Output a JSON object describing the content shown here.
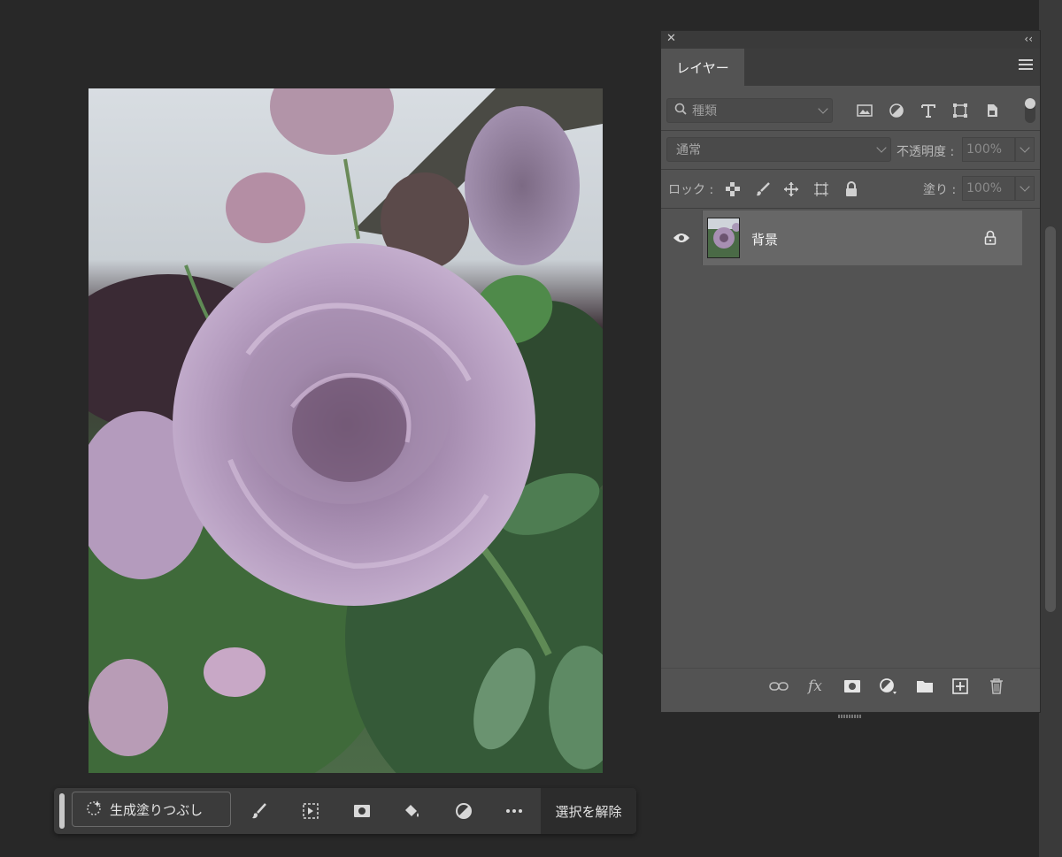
{
  "taskbar": {
    "generative_fill_label": "生成塗りつぶし",
    "deselect_label": "選択を解除",
    "icons": [
      "sparkle-icon",
      "brush-icon",
      "selection-transform-icon",
      "mask-icon",
      "paint-bucket-icon",
      "adjustment-icon",
      "more-icon"
    ]
  },
  "layers_panel": {
    "tab_label": "レイヤー",
    "filter": {
      "placeholder": "種類",
      "icons": [
        "image-filter-icon",
        "adjustment-filter-icon",
        "type-filter-icon",
        "shape-filter-icon",
        "smart-object-filter-icon"
      ]
    },
    "blend_mode": "通常",
    "opacity_label": "不透明度 :",
    "opacity_value": "100%",
    "lock_label": "ロック :",
    "fill_label": "塗り :",
    "fill_value": "100%",
    "layers": [
      {
        "name": "背景",
        "visible": true,
        "locked": true
      }
    ],
    "footer_icons": [
      "link-icon",
      "fx-icon",
      "add-mask-icon",
      "adjustment-layer-icon",
      "group-folder-icon",
      "new-layer-icon",
      "trash-icon"
    ],
    "fx_text": "fx"
  },
  "colors": {
    "workspace": "#282828",
    "panel": "#535353",
    "selected_layer": "#676767",
    "taskbar": "#3b3b3b"
  }
}
